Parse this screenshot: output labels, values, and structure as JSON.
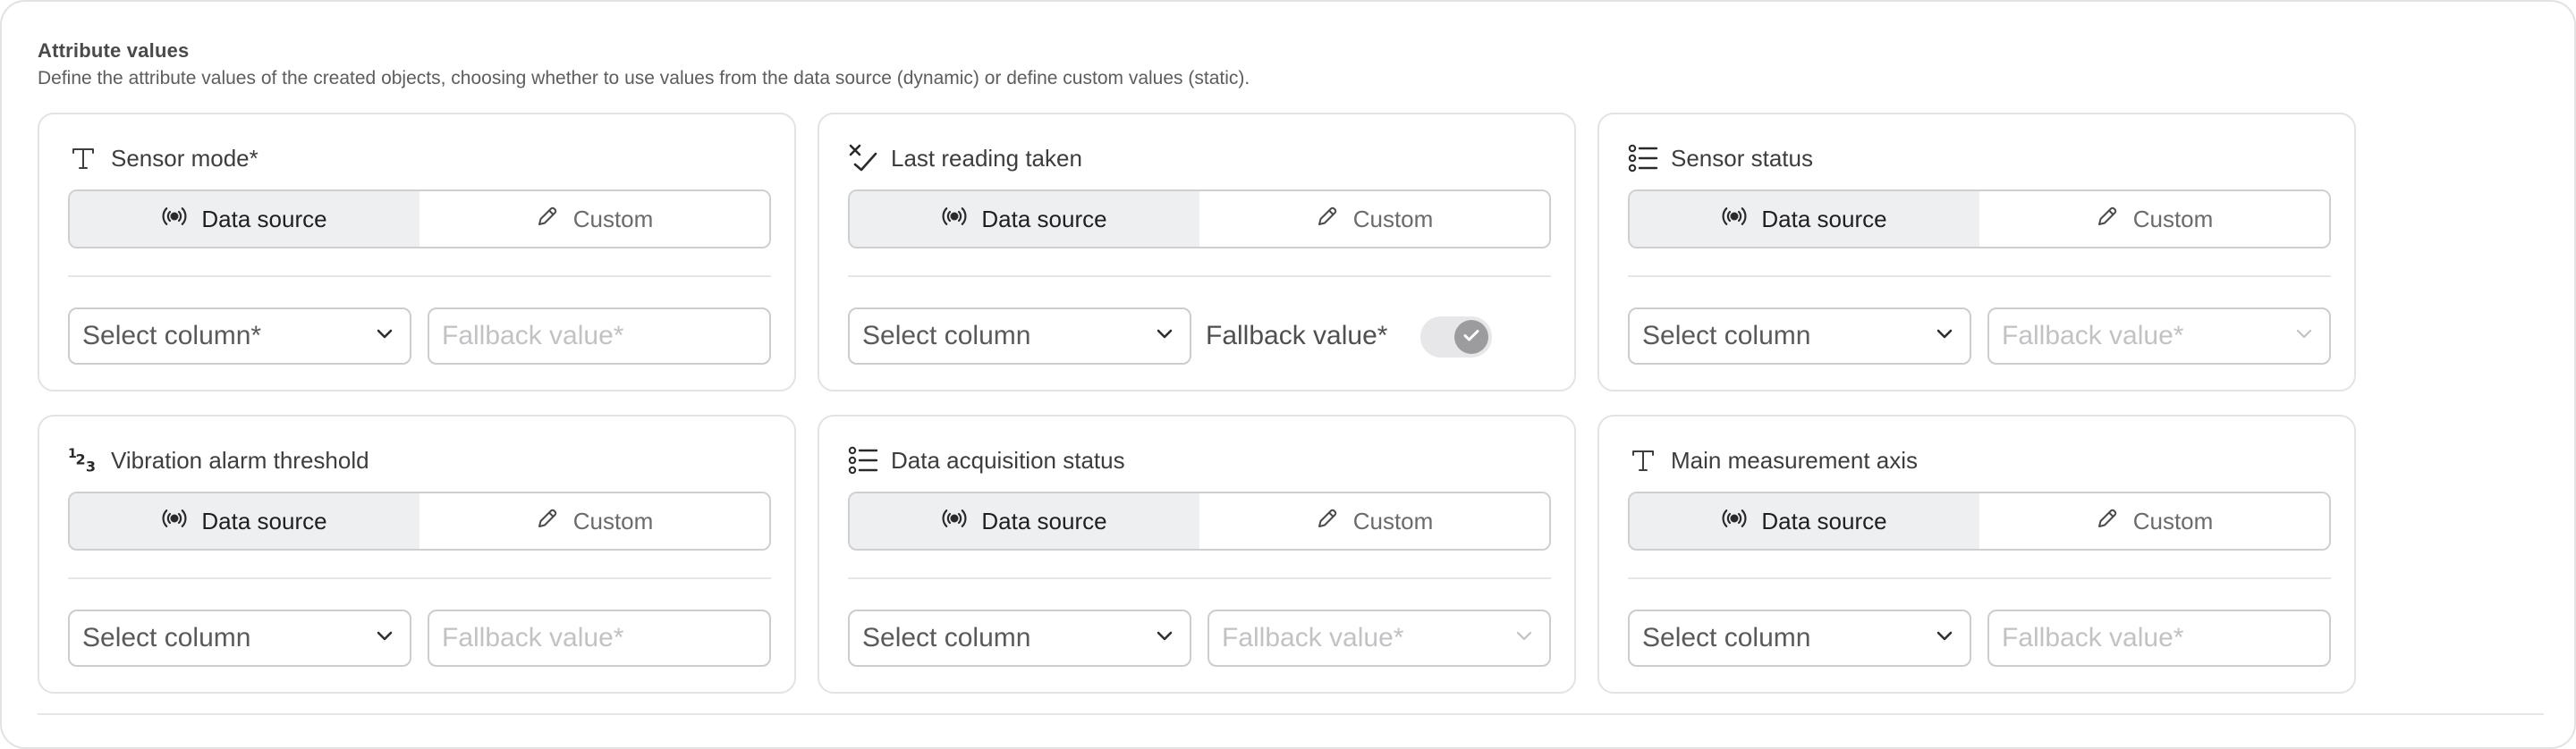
{
  "section": {
    "title": "Attribute values",
    "description": "Define the attribute values of the created objects, choosing whether to use values from the data source (dynamic) or define custom values (static)."
  },
  "icons": {
    "text": "text-type-icon",
    "datetime": "datetime-icon",
    "list": "list-type-icon",
    "number": "number-type-icon",
    "datasource": "broadcast-icon",
    "custom": "pencil-icon",
    "chevron": "chevron-down-icon",
    "check": "checkmark-icon"
  },
  "colors": {
    "border": "#e3e3e5",
    "active_segment": "#eeeff1",
    "placeholder": "#c2c2c5",
    "toggle_knob": "#9c9c9f"
  },
  "cards": [
    {
      "title": "Sensor mode*",
      "icon": "text-type-icon",
      "segments": {
        "data_source": "Data source",
        "custom": "Custom",
        "selected": "Data source"
      },
      "select_placeholder": "Select column*",
      "fallback": {
        "kind": "input",
        "placeholder": "Fallback value*"
      }
    },
    {
      "title": "Last reading taken",
      "icon": "datetime-icon",
      "segments": {
        "data_source": "Data source",
        "custom": "Custom",
        "selected": "Data source"
      },
      "select_placeholder": "Select column",
      "fallback": {
        "kind": "toggle",
        "label": "Fallback value*",
        "checked": true
      }
    },
    {
      "title": "Sensor status",
      "icon": "list-type-icon",
      "segments": {
        "data_source": "Data source",
        "custom": "Custom",
        "selected": "Data source"
      },
      "select_placeholder": "Select column",
      "fallback": {
        "kind": "dropdown",
        "placeholder": "Fallback value*"
      }
    },
    {
      "title": "Vibration alarm threshold",
      "icon": "number-type-icon",
      "segments": {
        "data_source": "Data source",
        "custom": "Custom",
        "selected": "Data source"
      },
      "select_placeholder": "Select column",
      "fallback": {
        "kind": "input",
        "placeholder": "Fallback value*"
      }
    },
    {
      "title": "Data acquisition status",
      "icon": "list-type-icon",
      "segments": {
        "data_source": "Data source",
        "custom": "Custom",
        "selected": "Data source"
      },
      "select_placeholder": "Select column",
      "fallback": {
        "kind": "dropdown",
        "placeholder": "Fallback value*"
      }
    },
    {
      "title": "Main measurement axis",
      "icon": "text-type-icon",
      "segments": {
        "data_source": "Data source",
        "custom": "Custom",
        "selected": "Data source"
      },
      "select_placeholder": "Select column",
      "fallback": {
        "kind": "input",
        "placeholder": "Fallback value*"
      }
    }
  ]
}
